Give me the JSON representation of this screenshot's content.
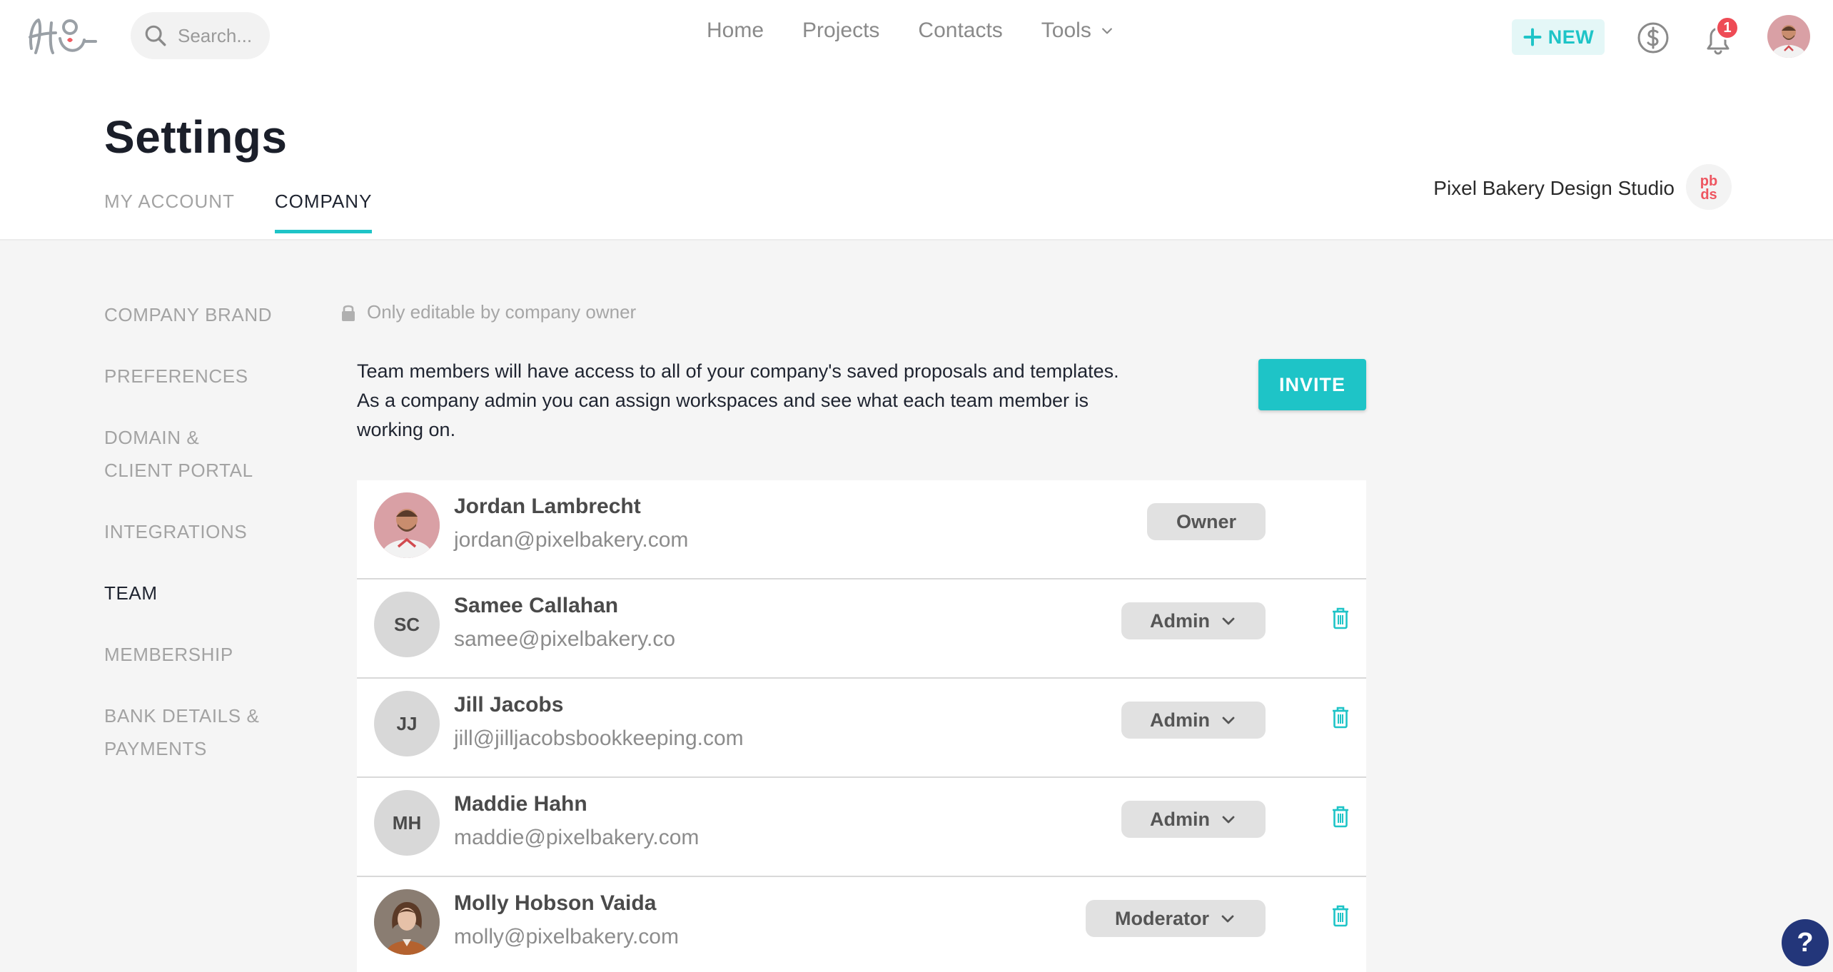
{
  "nav": {
    "search_placeholder": "Search...",
    "items": [
      {
        "label": "Home"
      },
      {
        "label": "Projects"
      },
      {
        "label": "Contacts"
      },
      {
        "label": "Tools"
      }
    ],
    "new_label": "NEW",
    "notification_count": "1"
  },
  "header": {
    "title": "Settings",
    "tabs": [
      {
        "label": "MY ACCOUNT"
      },
      {
        "label": "COMPANY"
      }
    ],
    "company_name": "Pixel Bakery Design Studio",
    "company_logo_text": "pb ds"
  },
  "side_menu": {
    "items": [
      {
        "label": "COMPANY BRAND"
      },
      {
        "label": "PREFERENCES"
      },
      {
        "label": "DOMAIN &\nCLIENT PORTAL"
      },
      {
        "label": "INTEGRATIONS"
      },
      {
        "label": "TEAM"
      },
      {
        "label": "MEMBERSHIP"
      },
      {
        "label": "BANK DETAILS &\nPAYMENTS"
      }
    ]
  },
  "main": {
    "lock_note": "Only editable by company owner",
    "description": "Team members will have access to all of your company's saved proposals and templates. As a company admin you can assign workspaces and see what each team member is working on.",
    "invite_label": "INVITE",
    "members": [
      {
        "name": "Jordan Lambrecht",
        "email": "jordan@pixelbakery.com",
        "role": "Owner",
        "initials": ""
      },
      {
        "name": "Samee Callahan",
        "email": "samee@pixelbakery.co",
        "role": "Admin",
        "initials": "SC"
      },
      {
        "name": "Jill Jacobs",
        "email": "jill@jilljacobsbookkeeping.com",
        "role": "Admin",
        "initials": "JJ"
      },
      {
        "name": "Maddie Hahn",
        "email": "maddie@pixelbakery.com",
        "role": "Admin",
        "initials": "MH"
      },
      {
        "name": "Molly Hobson Vaida",
        "email": "molly@pixelbakery.com",
        "role": "Moderator",
        "initials": ""
      }
    ]
  },
  "help_label": "?",
  "colors": {
    "accent": "#1ec4c7",
    "badge": "#ee4b55",
    "help": "#23367a"
  }
}
